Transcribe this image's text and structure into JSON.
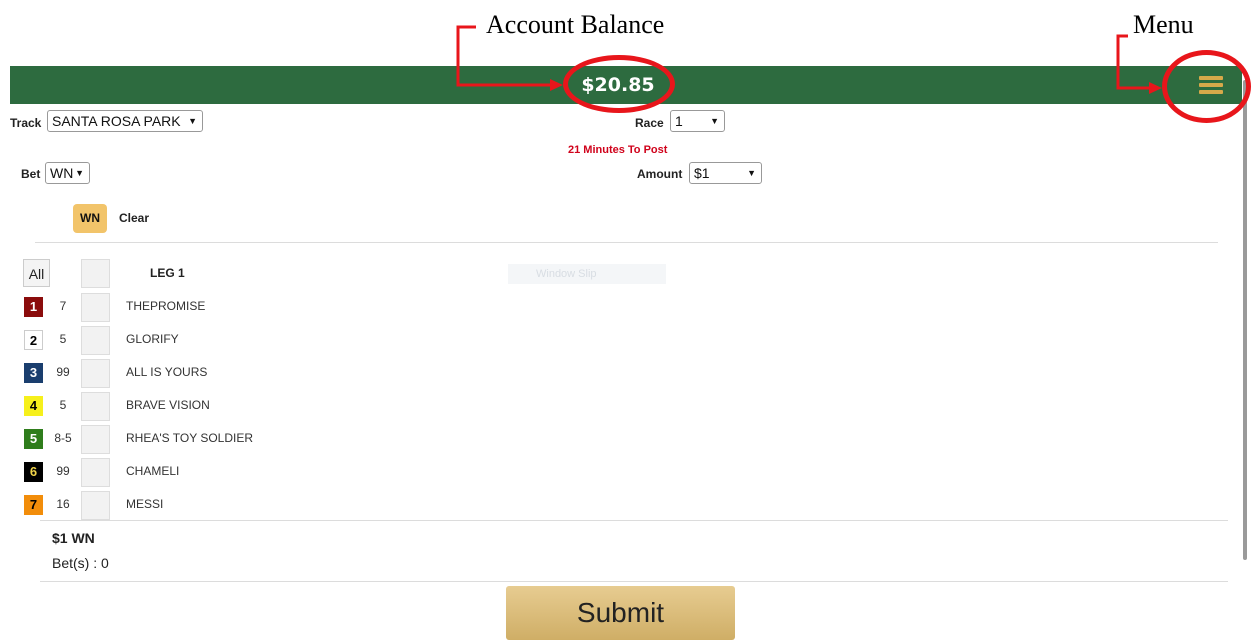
{
  "annotations": {
    "balance_label": "Account Balance",
    "menu_label": "Menu"
  },
  "header": {
    "balance": "$20.85",
    "bar_color": "#2d6b3f",
    "menu_icon": "hamburger-menu-icon"
  },
  "form": {
    "track_label": "Track",
    "track_value": "SANTA ROSA PARK",
    "race_label": "Race",
    "race_value": "1",
    "post_time": "21 Minutes To Post",
    "bet_label": "Bet",
    "bet_value": "WN",
    "amount_label": "Amount",
    "amount_value": "$1",
    "chip_label": "WN",
    "clear_label": "Clear"
  },
  "runners_header": {
    "all_label": "All",
    "leg_label": "LEG  1",
    "window_slip_label": "Window Slip"
  },
  "runners": [
    {
      "pp": "1",
      "odds": "7",
      "name": "THEPROMISE",
      "bg": "#8b0c0c",
      "fg": "#ffffff"
    },
    {
      "pp": "2",
      "odds": "5",
      "name": "GLORIFY",
      "bg": "#ffffff",
      "fg": "#000000"
    },
    {
      "pp": "3",
      "odds": "99",
      "name": "ALL IS YOURS",
      "bg": "#1a3e6e",
      "fg": "#ffffff"
    },
    {
      "pp": "4",
      "odds": "5",
      "name": "BRAVE VISION",
      "bg": "#f6f01c",
      "fg": "#000000"
    },
    {
      "pp": "5",
      "odds": "8-5",
      "name": "RHEA'S TOY SOLDIER",
      "bg": "#2f7d1c",
      "fg": "#ffffff"
    },
    {
      "pp": "6",
      "odds": "99",
      "name": "CHAMELI",
      "bg": "#000000",
      "fg": "#f1d54a"
    },
    {
      "pp": "7",
      "odds": "16",
      "name": "MESSI",
      "bg": "#f28d0a",
      "fg": "#000000"
    }
  ],
  "summary": {
    "amount_type": "$1 WN",
    "bet_count": "Bet(s) : 0"
  },
  "submit_label": "Submit",
  "colors": {
    "annotation": "#e8161b",
    "submit": "#d8b873",
    "post_time": "#d0021b"
  }
}
